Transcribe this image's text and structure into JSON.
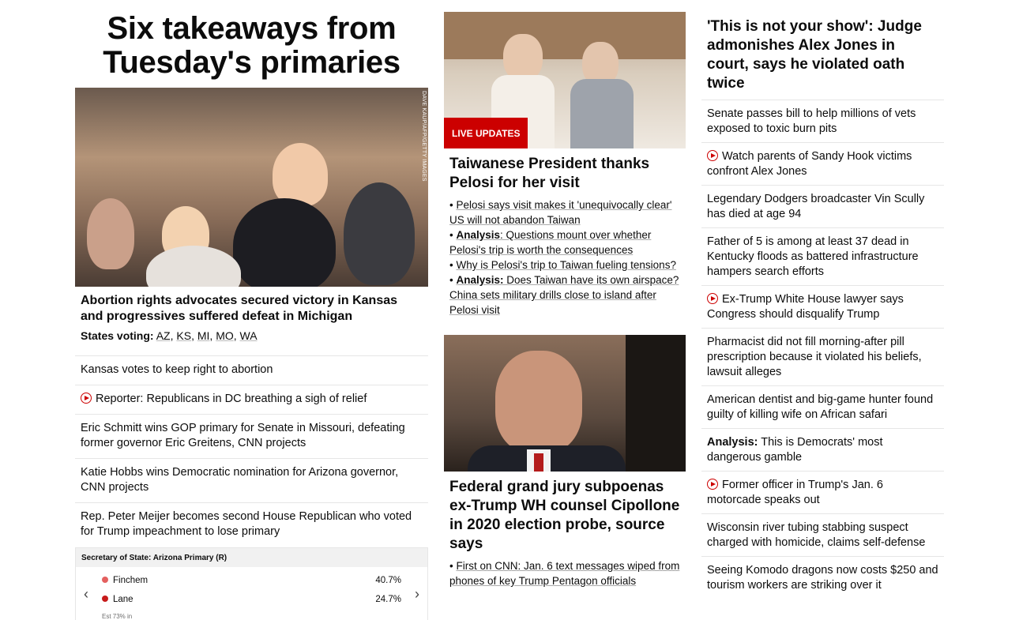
{
  "hero": {
    "title": "Six takeaways from Tuesday's primaries",
    "image_credit": "DAVE KAUP/AFP/GETTY IMAGES",
    "lead_headline": "Abortion rights advocates secured victory in Kansas and progressives suffered defeat in Michigan",
    "states_label": "States voting:",
    "states": [
      "AZ",
      "KS",
      "MI",
      "MO",
      "WA"
    ]
  },
  "col1_list": [
    {
      "text": "Kansas votes to keep right to abortion",
      "video": false
    },
    {
      "text": "Reporter: Republicans in DC breathing a sigh of relief",
      "video": true
    },
    {
      "text": "Eric Schmitt wins GOP primary for Senate in Missouri, defeating former governor Eric Greitens, CNN projects",
      "video": false
    },
    {
      "text": "Katie Hobbs wins Democratic nomination for Arizona governor, CNN projects",
      "video": false
    },
    {
      "text": "Rep. Peter Meijer becomes second House Republican who voted for Trump impeachment to lose primary",
      "video": false
    }
  ],
  "results": {
    "title": "Secretary of State: Arizona Primary (R)",
    "candidates": [
      {
        "name": "Finchem",
        "pct": "40.7%",
        "color": "#e4605f"
      },
      {
        "name": "Lane",
        "pct": "24.7%",
        "color": "#c71b1b"
      }
    ],
    "est": "Est 73% in",
    "prev": "‹",
    "next": "›"
  },
  "story2": {
    "badge": "LIVE UPDATES",
    "headline": "Taiwanese President thanks Pelosi for her visit",
    "bullets": [
      {
        "prefix": "",
        "text": "Pelosi says visit makes it 'unequivocally clear' US will not abandon Taiwan"
      },
      {
        "prefix": "Analysis",
        "text": ": Questions mount over whether Pelosi's trip is worth the consequences"
      },
      {
        "prefix": "",
        "text": "Why is Pelosi's trip to Taiwan fueling tensions?"
      },
      {
        "prefix": "Analysis:",
        "text": " Does Taiwan have its own airspace? China sets military drills close to island after Pelosi visit"
      }
    ]
  },
  "story3": {
    "headline": "Federal grand jury subpoenas ex-Trump WH counsel Cipollone in 2020 election probe, source says",
    "bullets": [
      {
        "prefix": "",
        "text": "First on CNN: Jan. 6 text messages wiped from phones of key Trump Pentagon officials"
      }
    ]
  },
  "col3": {
    "headline": "'This is not your show': Judge admonishes Alex Jones in court, says he violated oath twice",
    "items": [
      {
        "prefix": "",
        "text": "Senate passes bill to help millions of vets exposed to toxic burn pits",
        "video": false
      },
      {
        "prefix": "",
        "text": "Watch parents of Sandy Hook victims confront Alex Jones",
        "video": true
      },
      {
        "prefix": "",
        "text": "Legendary Dodgers broadcaster Vin Scully has died at age 94",
        "video": false
      },
      {
        "prefix": "",
        "text": "Father of 5 is among at least 37 dead in Kentucky floods as battered infrastructure hampers search efforts",
        "video": false
      },
      {
        "prefix": "",
        "text": "Ex-Trump White House lawyer says Congress should disqualify Trump",
        "video": true
      },
      {
        "prefix": "",
        "text": "Pharmacist did not fill morning-after pill prescription because it violated his beliefs, lawsuit alleges",
        "video": false
      },
      {
        "prefix": "",
        "text": "American dentist and big-game hunter found guilty of killing wife on African safari",
        "video": false
      },
      {
        "prefix": "Analysis:",
        "text": " This is Democrats' most dangerous gamble",
        "video": false
      },
      {
        "prefix": "",
        "text": "Former officer in Trump's Jan. 6 motorcade speaks out",
        "video": true
      },
      {
        "prefix": "",
        "text": "Wisconsin river tubing stabbing suspect charged with homicide, claims self-defense",
        "video": false
      },
      {
        "prefix": "",
        "text": "Seeing Komodo dragons now costs $250 and tourism workers are striking over it",
        "video": false
      }
    ]
  }
}
